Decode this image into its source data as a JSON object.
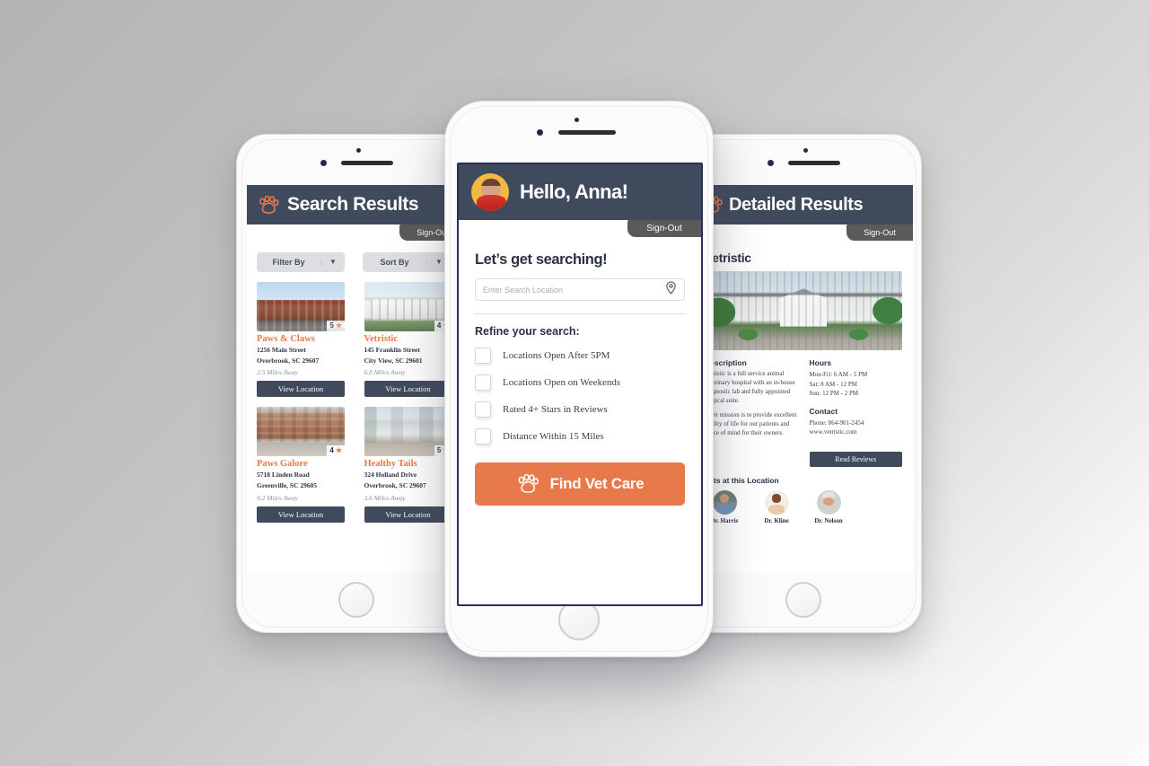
{
  "app": {
    "accent_orange": "#E8794B",
    "navy": "#3F4A5C",
    "signout_gray": "#5A5A5A"
  },
  "left_phone": {
    "header": {
      "title": "Search Results",
      "icon": "paw-icon"
    },
    "signout": "Sign-Out",
    "controls": [
      {
        "label": "Filter By",
        "icon": "chevron-down-icon"
      },
      {
        "label": "Sort By",
        "icon": "chevron-down-icon"
      }
    ],
    "results": [
      {
        "name": "Paws & Claws",
        "rating": "5",
        "address_line1": "1256 Main Street",
        "address_line2": "Overbrook, SC 29607",
        "distance": "2.5 Miles Away",
        "button": "View Location",
        "photo": "brick-apartment-building"
      },
      {
        "name": "Vetristic",
        "rating": "4",
        "address_line1": "145 Franklin Street",
        "address_line2": "City View, SC 29601",
        "distance": "6.8 Miles Away",
        "button": "View Location",
        "photo": "white-colonial-building"
      },
      {
        "name": "Paws Galore",
        "rating": "4",
        "address_line1": "5718 Linden Road",
        "address_line2": "Greenville, SC 29605",
        "distance": "9.2 Miles Away",
        "button": "View Location",
        "photo": "brick-street-row"
      },
      {
        "name": "Healthy Tails",
        "rating": "5",
        "address_line1": "324 Holland Drive",
        "address_line2": "Overbrook, SC 29607",
        "distance": "3.6 Miles Away",
        "button": "View Location",
        "photo": "white-street-row"
      }
    ]
  },
  "center_phone": {
    "greeting": "Hello, Anna!",
    "avatar": "user-avatar-anna",
    "signout": "Sign-Out",
    "heading": "Let’s get searching!",
    "search": {
      "placeholder": "Enter Search Location",
      "value": "",
      "icon": "location-pin-icon"
    },
    "refine_heading": "Refine your search:",
    "filters": [
      {
        "label": "Locations Open After 5PM",
        "checked": false
      },
      {
        "label": "Locations Open on Weekends",
        "checked": false
      },
      {
        "label": "Rated 4+ Stars in Reviews",
        "checked": false
      },
      {
        "label": "Distance Within 15 Miles",
        "checked": false
      }
    ],
    "cta": {
      "label": "Find Vet Care",
      "icon": "paw-icon"
    }
  },
  "right_phone": {
    "header": {
      "title": "Detailed Results",
      "icon": "paw-icon"
    },
    "signout": "Sign-Out",
    "clinic_name": "Vetristic",
    "hero_photo": "clinic-campus-building",
    "description": {
      "heading": "Description",
      "paragraphs": [
        "Vetristic is a full service animal veterinary hospital with an in-house diagnostic lab and fully appointed surgical suite.",
        "Their mission is to provide excellent quality of life for our patients and peace of mind for their owners."
      ]
    },
    "hours": {
      "heading": "Hours",
      "lines": [
        "Mon-Fri: 6 AM - 5 PM",
        "Sat: 8 AM - 12 PM",
        "Sun: 12 PM - 2 PM"
      ]
    },
    "contact": {
      "heading": "Contact",
      "lines": [
        "Phone: 864-901-2454",
        "www.vetristic.com"
      ]
    },
    "reviews_button": "Read Reviews",
    "vets_heading": "Vets at this Location",
    "vets": [
      {
        "name": "Dr. Harris",
        "avatar": "vet-avatar-harris"
      },
      {
        "name": "Dr. Kline",
        "avatar": "vet-avatar-kline"
      },
      {
        "name": "Dr. Nelson",
        "avatar": "vet-avatar-nelson"
      }
    ]
  }
}
